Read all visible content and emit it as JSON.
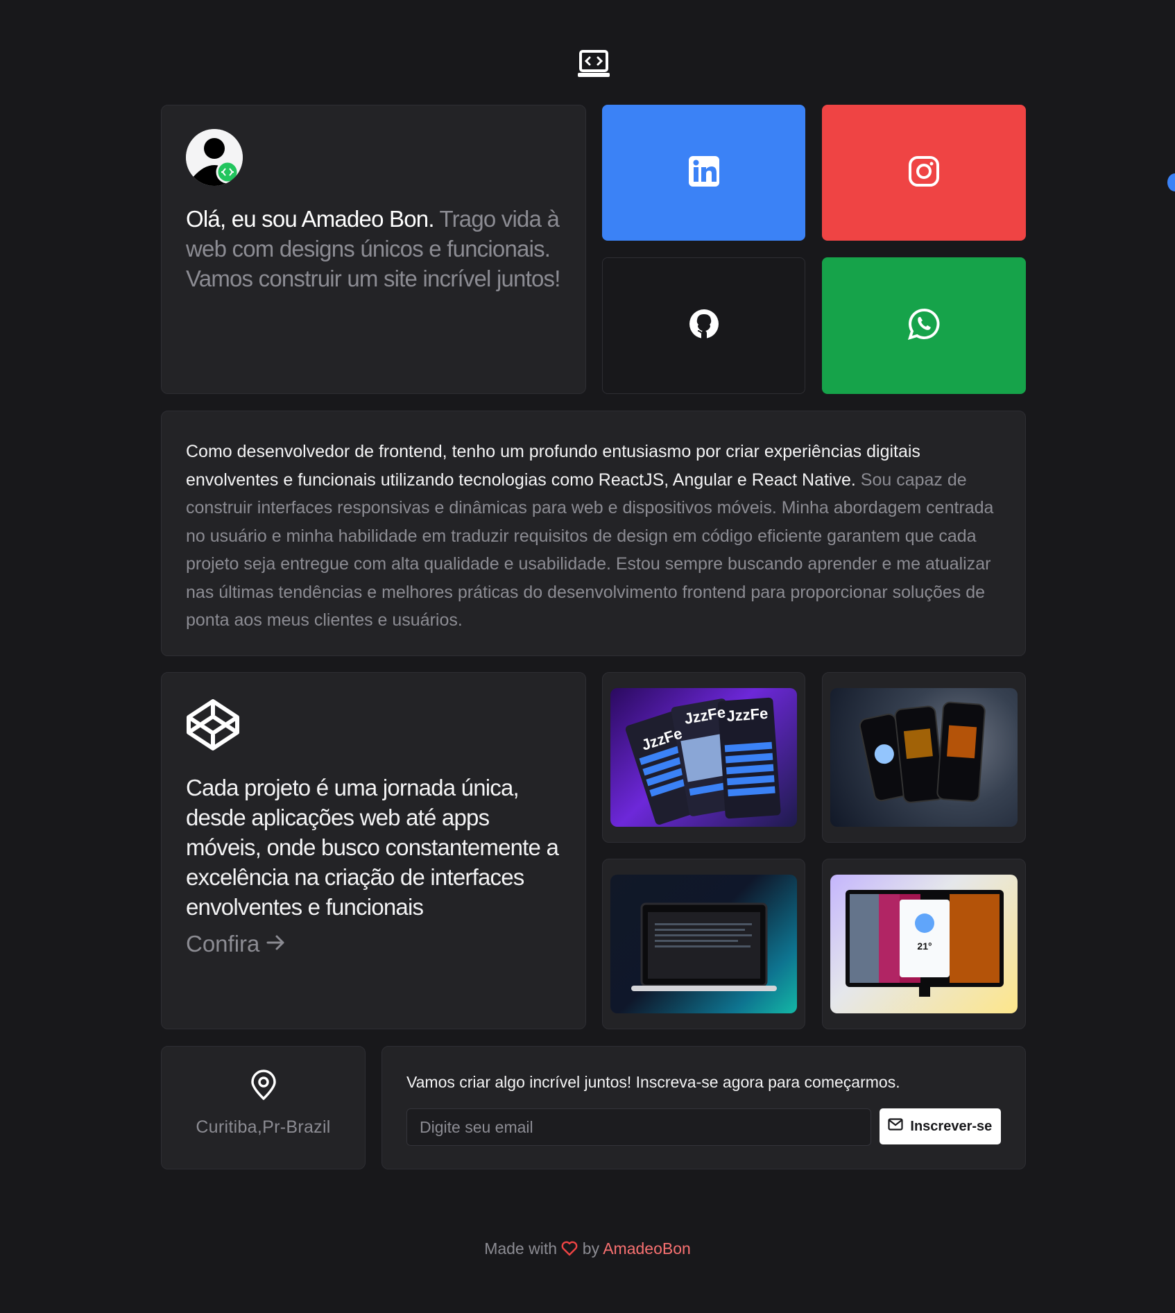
{
  "header": {
    "logo_icon": "laptop-code-icon"
  },
  "intro": {
    "avatar_icon": "user-avatar",
    "highlight": "Olá, eu sou Amadeo Bon.",
    "text": " Trago vida à web com designs únicos e funcionais. Vamos construir um site incrível juntos!"
  },
  "social": [
    {
      "name": "LinkedIn",
      "icon": "linkedin-icon",
      "color": "#3b82f6"
    },
    {
      "name": "Instagram",
      "icon": "instagram-icon",
      "color": "#ef4444"
    },
    {
      "name": "GitHub",
      "icon": "github-icon",
      "color": "#18181b"
    },
    {
      "name": "WhatsApp",
      "icon": "whatsapp-icon",
      "color": "#16a34a"
    }
  ],
  "about": {
    "highlight": "Como desenvolvedor de frontend, tenho um profundo entusiasmo por criar experiências digitais envolventes e funcionais utilizando tecnologias como ReactJS, Angular e React Native.",
    "text": " Sou capaz de construir interfaces responsivas e dinâmicas para web e dispositivos móveis. Minha abordagem centrada no usuário e minha habilidade em traduzir requisitos de design em código eficiente garantem que cada projeto seja entregue com alta qualidade e usabilidade. Estou sempre buscando aprender e me atualizar nas últimas tendências e melhores práticas do desenvolvimento frontend para proporcionar soluções de ponta aos meus clientes e usuários."
  },
  "projects": {
    "icon": "codepen-icon",
    "heading": "Cada projeto é uma jornada única, desde aplicações web até apps móveis, onde busco constantemente a excelência na criação de interfaces envolventes e funcionais",
    "link_label": "Confira",
    "thumb_labels": [
      "JzzFe",
      "JzzFe",
      "JzzFe",
      "21°"
    ]
  },
  "location": {
    "icon": "map-pin-icon",
    "text": "Curitiba,Pr-Brazil"
  },
  "subscribe": {
    "text": "Vamos criar algo incrível juntos! Inscreva-se agora para começarmos.",
    "placeholder": "Digite seu email",
    "button_label": "Inscrever-se",
    "button_icon": "mail-icon"
  },
  "footer": {
    "prefix": "Made with",
    "middle": "by",
    "author": "AmadeoBon"
  }
}
